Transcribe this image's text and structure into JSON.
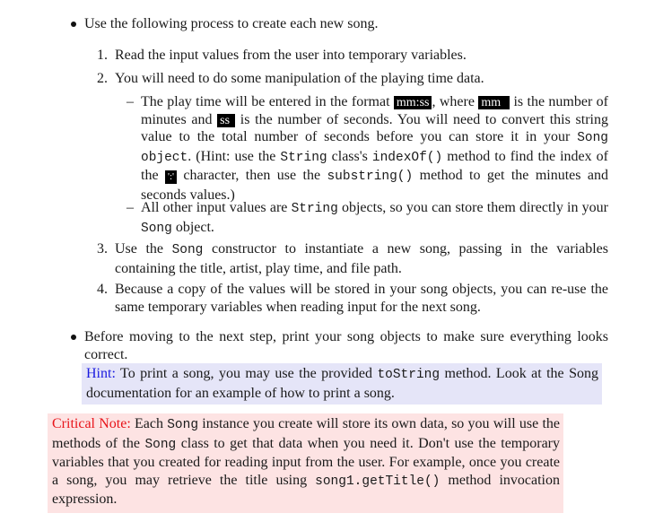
{
  "document": {
    "bullet1": {
      "text": "Use the following process to create each new song."
    },
    "steps": [
      {
        "num": "1.",
        "text": "Read the input values from the user into temporary variables."
      },
      {
        "num": "2.",
        "text": "You will need to do some manipulation of the playing time data."
      },
      {
        "num": "3.",
        "parts": [
          "Use the ",
          "Song",
          " constructor to instantiate a new song, passing in the variables containing the title, artist, play time, and file path."
        ]
      },
      {
        "num": "4.",
        "text": "Because a copy of the values will be stored in your song objects, you can re-use the same temporary variables when reading input for the next song."
      }
    ],
    "subitems": {
      "dash": "–",
      "item1": {
        "t1": "The play time will be entered in the format ",
        "box1": "mm:ss",
        "t2": ", where ",
        "box2": "mm",
        "t3": " is the number of minutes and ",
        "box3": "ss",
        "t4": " is the number of seconds. You will need to convert this string value to the total number of seconds before you can store it in your ",
        "code1": "Song object",
        "t5": ". (Hint: use the ",
        "code2": "String",
        "t6": " class's ",
        "code3": "indexOf()",
        "t7": " method to find the index of the ",
        "box4": "':'",
        "t8": " character, then use the ",
        "code4": "substring()",
        "t9": " method to get the minutes and seconds values.)"
      },
      "item2": {
        "t1": "All other input values are ",
        "code1": "String",
        "t2": " objects, so you can store them directly in your ",
        "code2": "Song",
        "t3": " object."
      }
    },
    "bullet2": {
      "text": "Before moving to the next step, print your song objects to make sure everything looks correct."
    },
    "hint": {
      "label": "Hint:",
      "t1": " To print a song, you may use the provided ",
      "code": "toString",
      "t2": " method. Look at the Song documentation for an example of how to print a song."
    },
    "critical": {
      "label": "Critical Note:",
      "t1": " Each ",
      "code1": "Song",
      "t2": " instance you create will store its own data, so you will use the methods of the ",
      "code2": "Song",
      "t3": " class to get that data when you need it. Don't use the temporary variables that you created for reading input from the user. For example, once you create a song, you may retrieve the title using ",
      "code3": "song1.getTitle()",
      "t4": " method invocation expression."
    },
    "colors": {
      "hint_label": "#1a1adf",
      "hint_bg": "#e5e5f8",
      "critical_label": "#e8141a",
      "critical_bg": "#fde3e3"
    }
  }
}
